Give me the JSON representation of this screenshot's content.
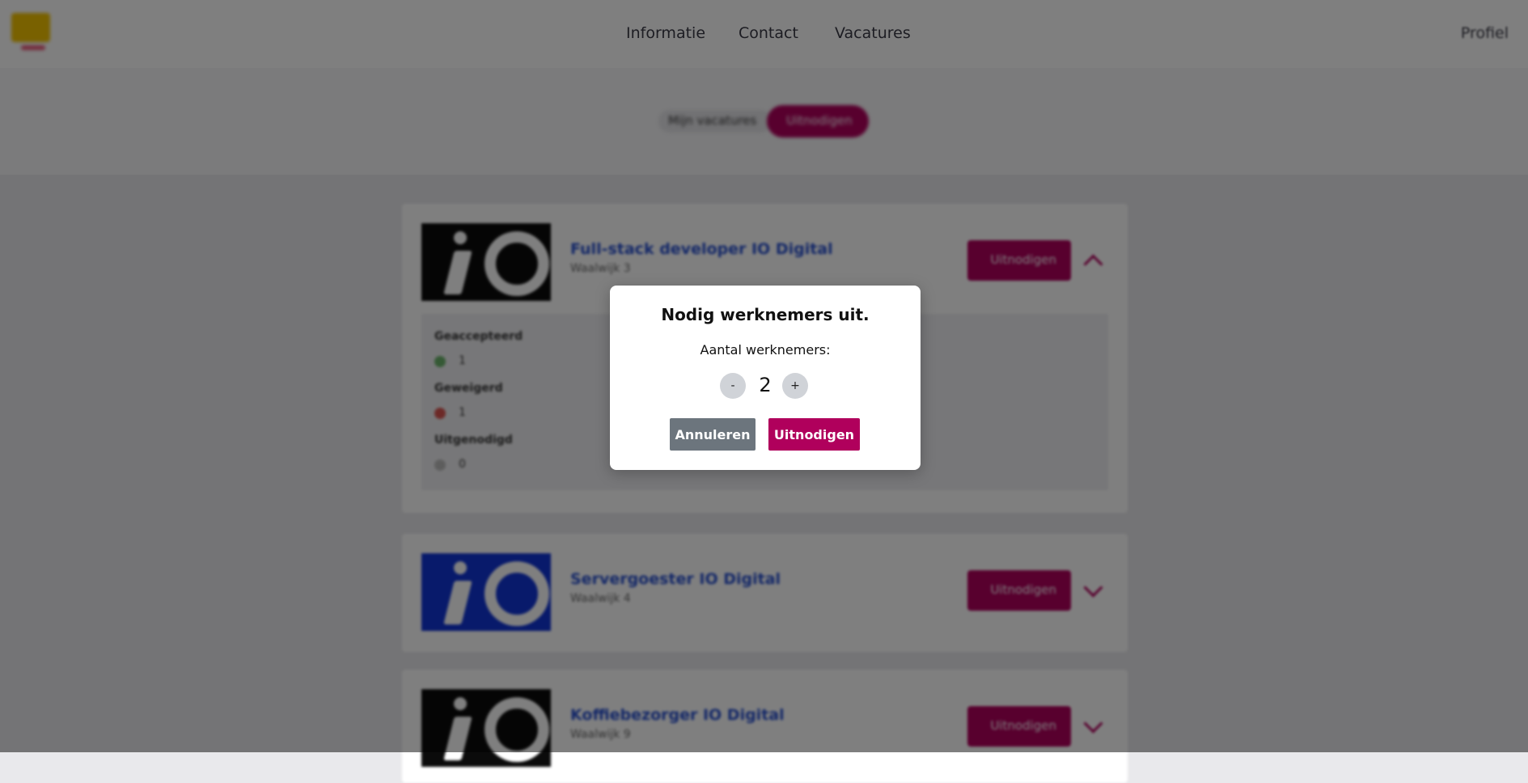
{
  "header": {
    "nav": [
      "Informatie",
      "Contact",
      "Vacatures"
    ],
    "profile": "Profiel"
  },
  "filter": {
    "left_label": "Mijn vacatures",
    "right_label": "Uitnodigen"
  },
  "vacancies": [
    {
      "title": "Full-stack developer IO Digital",
      "subtitle": "Waalwijk 3",
      "button": "Uitnodigen"
    },
    {
      "title": "Servergoester IO Digital",
      "subtitle": "Waalwijk 4",
      "button": "Uitnodigen"
    },
    {
      "title": "Koffiebezorger IO Digital",
      "subtitle": "Waalwijk 9",
      "button": "Uitnodigen"
    }
  ],
  "details": {
    "accepted_label": "Geaccepteerd",
    "accepted_value": "1",
    "rejected_label": "Geweigerd",
    "rejected_value": "1",
    "invited_label": "Uitgenodigd",
    "invited_value": "0"
  },
  "modal": {
    "title": "Nodig werknemers uit.",
    "label": "Aantal werknemers:",
    "minus": "-",
    "plus": "+",
    "count": "2",
    "cancel": "Annuleren",
    "invite": "Uitnodigen"
  },
  "colors": {
    "brand": "#b0005c",
    "cancel": "#6c757d"
  }
}
